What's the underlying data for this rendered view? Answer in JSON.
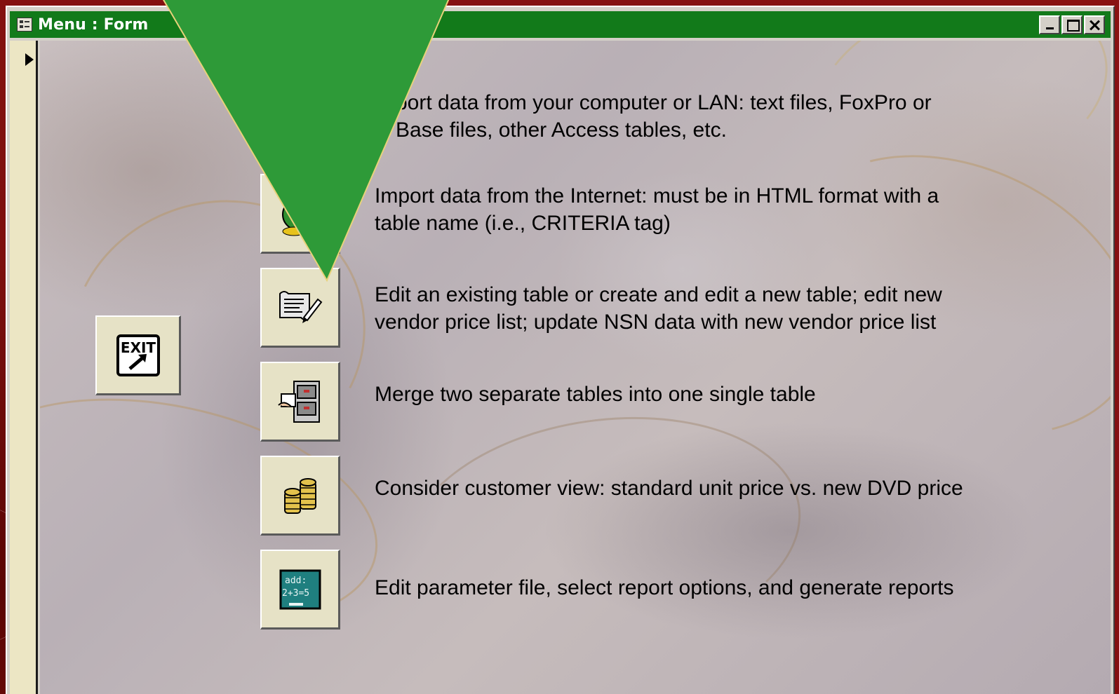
{
  "window": {
    "title": "Menu : Form"
  },
  "exit_button": {
    "label": "EXIT"
  },
  "menu_items": [
    {
      "icon": "import-file-icon",
      "description": "Import data from your computer or LAN: text files, FoxPro or dBase files, other Access tables, etc."
    },
    {
      "icon": "internet-globe-icon",
      "description": "Import data from the Internet: must be in HTML format with a table name (i.e., CRITERIA tag)"
    },
    {
      "icon": "edit-table-icon",
      "description": "Edit an existing table or create and edit a new table; edit new vendor price list; update NSN data with new vendor price list"
    },
    {
      "icon": "merge-tables-icon",
      "description": "Merge two separate tables into one single table"
    },
    {
      "icon": "coins-icon",
      "description": "Consider customer view: standard unit price vs. new DVD price"
    },
    {
      "icon": "parameter-board-icon",
      "description": "Edit parameter file, select report options, and generate reports",
      "icon_text": [
        "add:",
        "2+3=5"
      ]
    }
  ],
  "visible_text": {
    "line1a": "port data from your computer or LAN: text files, FoxPro or",
    "line1b": "Base files, other Access tables, etc.",
    "line2a": "Import data from the Internet: must be in HTML format with a",
    "line2b": "table name (i.e., CRITERIA tag)",
    "line3a": "Edit an existing table or create and edit a new table; edit new",
    "line3b": "vendor price list; update NSN data with new vendor price list",
    "line4": "Merge two separate tables into one single table",
    "line5": "Consider customer view: standard unit price vs. new DVD price",
    "line6": "Edit parameter file, select report options, and generate reports"
  },
  "colors": {
    "titlebar": "#127a1a",
    "overlay_arrow": "#2e9a38",
    "overlay_arrow_outline": "#e8d27a",
    "slide_background": "#7d0f0f"
  }
}
